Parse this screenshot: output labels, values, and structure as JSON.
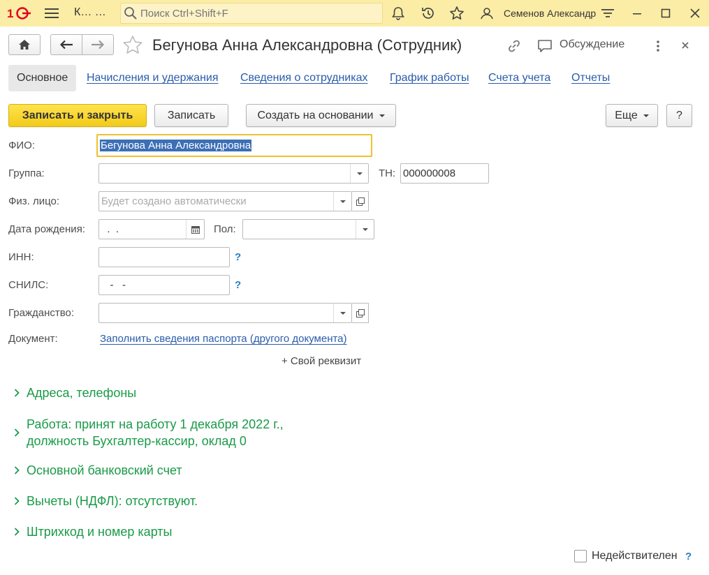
{
  "topbar": {
    "app_name": "К…  …",
    "search_placeholder": "Поиск Ctrl+Shift+F",
    "user_name": "Семенов Александр"
  },
  "header": {
    "title": "Бегунова Анна Александровна (Сотрудник)",
    "discuss_label": "Обсуждение"
  },
  "tabs": [
    {
      "label": "Основное"
    },
    {
      "label": "Начисления и удержания"
    },
    {
      "label": "Сведения о сотрудниках"
    },
    {
      "label": "График работы"
    },
    {
      "label": "Счета учета"
    },
    {
      "label": "Отчеты"
    }
  ],
  "toolbar": {
    "save_close": "Записать и закрыть",
    "save": "Записать",
    "create_based": "Создать на основании",
    "more": "Еще",
    "help": "?"
  },
  "form": {
    "fio_label": "ФИО:",
    "fio_value": "Бегунова Анна Александровна",
    "group_label": "Группа:",
    "group_value": "",
    "tn_label": "ТН:",
    "tn_value": "000000008",
    "person_label": "Физ. лицо:",
    "person_placeholder": "Будет создано автоматически",
    "birth_label": "Дата рождения:",
    "birth_value": "  .  .",
    "sex_label": "Пол:",
    "sex_value": "",
    "inn_label": "ИНН:",
    "inn_value": "",
    "snils_label": "СНИЛС:",
    "snils_value": "   -   -",
    "citizenship_label": "Гражданство:",
    "citizenship_value": "",
    "document_label": "Документ:",
    "document_link": "Заполнить сведения паспорта (другого документа)",
    "help_mark": "?",
    "add_requisite": "+ Свой реквизит"
  },
  "groups": [
    {
      "label": "Адреса, телефоны"
    },
    {
      "label": "Работа: принят на работу 1 декабря 2022 г.,",
      "label2": "должность Бухгалтер-кассир, оклад 0"
    },
    {
      "label": "Основной банковский счет"
    },
    {
      "label": "Вычеты (НДФЛ): отсутствуют."
    },
    {
      "label": "Штрихкод и номер карты"
    }
  ],
  "footer": {
    "invalid_label": "Недействителен",
    "invalid_checked": false,
    "help_mark": "?"
  },
  "colors": {
    "title_bar": "#fbeda5",
    "primary_button": "#f2cb1a",
    "link": "#2a5caa",
    "group_text": "#1a9a48",
    "logo": "#e3001b"
  }
}
